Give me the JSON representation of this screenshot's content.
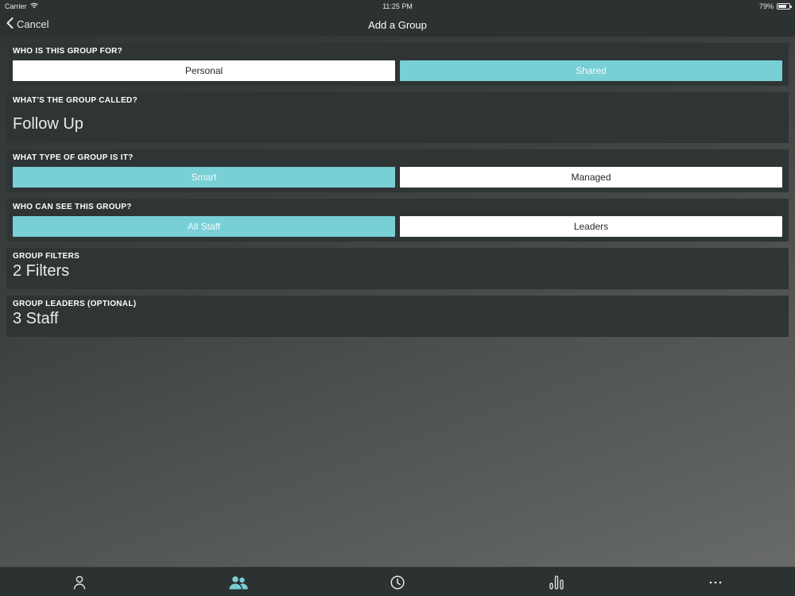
{
  "status_bar": {
    "carrier": "Carrier",
    "time": "11:25 PM",
    "battery": "79%",
    "battery_level": 0.79
  },
  "nav": {
    "cancel_label": "Cancel",
    "title": "Add a Group"
  },
  "sections": {
    "audience": {
      "label": "WHO IS THIS GROUP FOR?",
      "options": [
        "Personal",
        "Shared"
      ],
      "selected": "Shared"
    },
    "name": {
      "label": "WHAT'S THE GROUP CALLED?",
      "value": "Follow Up"
    },
    "type": {
      "label": "WHAT TYPE OF GROUP IS IT?",
      "options": [
        "Smart",
        "Managed"
      ],
      "selected": "Smart"
    },
    "visibility": {
      "label": "WHO CAN SEE THIS GROUP?",
      "options": [
        "All Staff",
        "Leaders"
      ],
      "selected": "All Staff"
    },
    "filters": {
      "label": "GROUP FILTERS",
      "value": "2 Filters"
    },
    "leaders": {
      "label": "GROUP LEADERS (OPTIONAL)",
      "value": "3 Staff"
    }
  },
  "tab_bar": {
    "tabs": [
      "person-icon",
      "people-icon",
      "clock-icon",
      "bar-chart-icon",
      "more-icon"
    ],
    "active_tab": "people-icon"
  },
  "colors": {
    "accent": "#78cfd6",
    "panel": "#2f3434",
    "bar": "#2c3131"
  }
}
